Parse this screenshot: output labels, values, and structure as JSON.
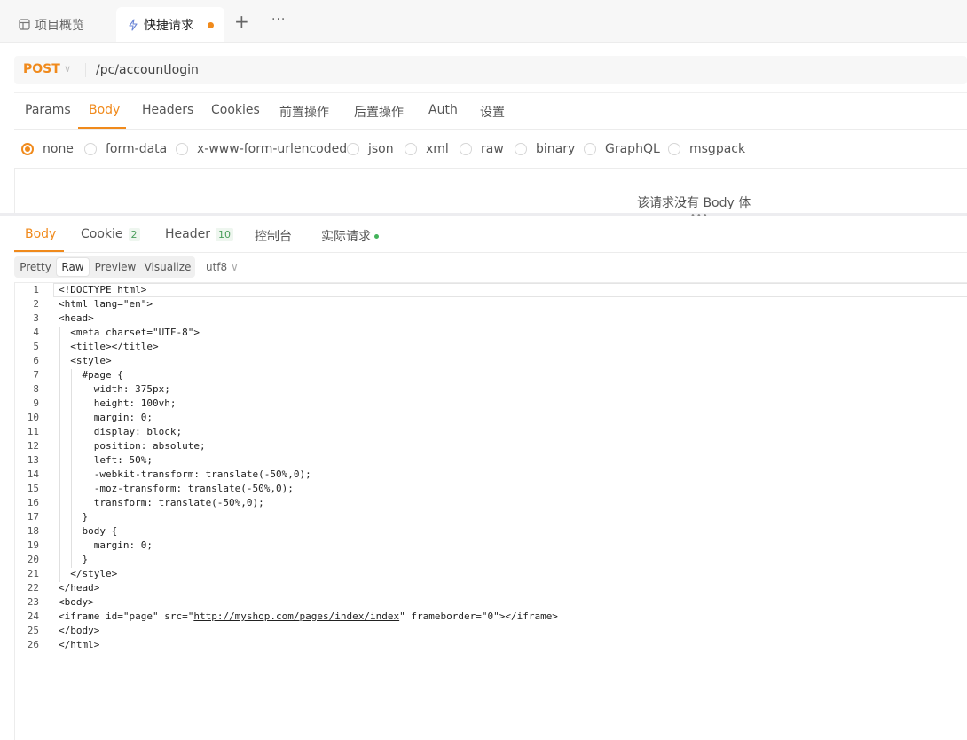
{
  "top_tabs": [
    {
      "label": "项目概览",
      "icon": "layout-icon"
    },
    {
      "label": "快捷请求",
      "icon": "lightning-icon",
      "unsaved": true
    }
  ],
  "top_actions": {
    "add": "+",
    "more": "···"
  },
  "request": {
    "method": "POST",
    "url": "/pc/accountlogin"
  },
  "request_tabs": [
    "Params",
    "Body",
    "Headers",
    "Cookies",
    "前置操作",
    "后置操作",
    "Auth",
    "设置"
  ],
  "active_request_tab": "Body",
  "body_types": [
    "none",
    "form-data",
    "x-www-form-urlencoded",
    "json",
    "xml",
    "raw",
    "binary",
    "GraphQL",
    "msgpack"
  ],
  "selected_body_type": "none",
  "no_body_text": "该请求没有 Body 体",
  "response_tabs": [
    {
      "label": "Body"
    },
    {
      "label": "Cookie",
      "count": "2"
    },
    {
      "label": "Header",
      "count": "10"
    },
    {
      "label": "控制台"
    },
    {
      "label": "实际请求"
    }
  ],
  "view_modes": [
    "Pretty",
    "Raw",
    "Preview",
    "Visualize"
  ],
  "active_view_mode": "Raw",
  "encoding": "utf8",
  "code_lines": [
    "<!DOCTYPE html>",
    "<html lang=\"en\">",
    "<head>",
    "  <meta charset=\"UTF-8\">",
    "  <title></title>",
    "  <style>",
    "    #page {",
    "      width: 375px;",
    "      height: 100vh;",
    "      margin: 0;",
    "      display: block;",
    "      position: absolute;",
    "      left: 50%;",
    "      -webkit-transform: translate(-50%,0);",
    "      -moz-transform: translate(-50%,0);",
    "      transform: translate(-50%,0);",
    "    }",
    "    body {",
    "      margin: 0;",
    "    }",
    "  </style>",
    "</head>",
    "<body>",
    "<iframe id=\"page\" src=\"http://myshop.com/pages/index/index\" frameborder=\"0\"></iframe>",
    "</body>",
    "</html>"
  ],
  "colors": {
    "accent": "#f08a1c",
    "badge_green": "#4a9e5c"
  }
}
